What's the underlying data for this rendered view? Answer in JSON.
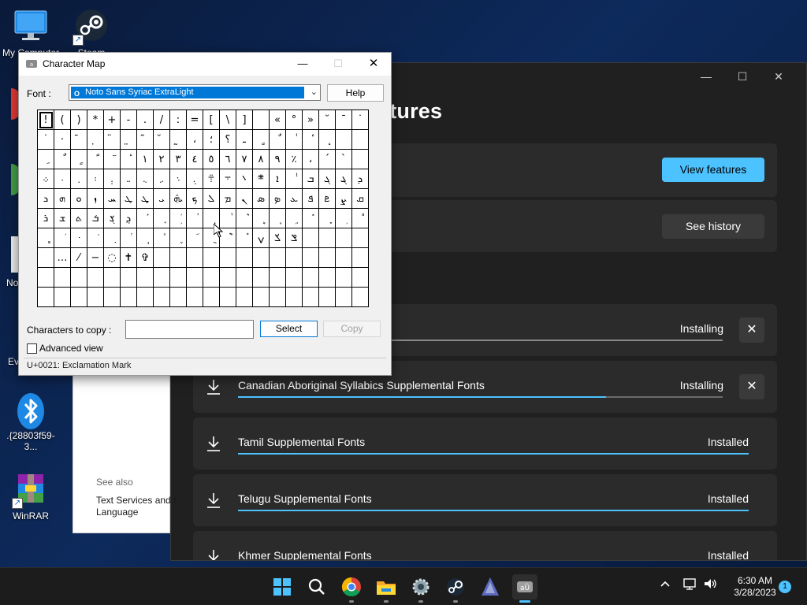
{
  "desktop": {
    "icons": [
      {
        "label": "My Computer"
      },
      {
        "label": "Steam"
      },
      {
        "label": ".{28803f59-3..."
      },
      {
        "label": "WinRAR"
      }
    ],
    "partial_labels": [
      "No",
      "Ev"
    ]
  },
  "settings": {
    "title_partial": "atures",
    "view_features_label": "View features",
    "see_history_label": "See history",
    "features": [
      {
        "name": "",
        "status": "Installing",
        "progress": 1.0,
        "cancellable": true
      },
      {
        "name": "Canadian Aboriginal Syllabics Supplemental Fonts",
        "status": "Installing",
        "progress": 0.76,
        "cancellable": true
      },
      {
        "name": "Tamil Supplemental Fonts",
        "status": "Installed",
        "progress": 1.0,
        "cancellable": false
      },
      {
        "name": "Telugu Supplemental Fonts",
        "status": "Installed",
        "progress": 1.0,
        "cancellable": false
      },
      {
        "name": "Khmer Supplemental Fonts",
        "status": "Installed",
        "progress": 1.0,
        "cancellable": false
      }
    ]
  },
  "white_panel": {
    "see_also": "See also",
    "link_line1": "Text Services and I",
    "link_line2": "Language"
  },
  "charmap": {
    "title": "Character Map",
    "font_label": "Font :",
    "font_value": "Noto Sans Syriac ExtraLight",
    "help_label": "Help",
    "copy_label": "Characters to copy :",
    "copy_value": "",
    "select_label": "Select",
    "copy_button_label": "Copy",
    "advanced_view_label": "Advanced view",
    "advanced_view_checked": false,
    "status": "U+0021: Exclamation Mark",
    "grid_rows": [
      [
        "!",
        "(",
        ")",
        "*",
        "+",
        "-",
        ".",
        "/",
        ":",
        "=",
        "[",
        "\\",
        "]",
        "",
        "«",
        "°",
        "»",
        "˘",
        "ˉ",
        "˙"
      ],
      [
        "˙",
        "·",
        "̄",
        "̣",
        "̈",
        "̤",
        "̃",
        "̆",
        "̰",
        "،",
        "؛",
        "؟",
        "ـ",
        "ٍ",
        "ٌ",
        "ٰ",
        "ٔ",
        "ٕ",
        "",
        ""
      ],
      [
        "ِ",
        "ٌ",
        "ٍ",
        "ً",
        "ٓ",
        "ٔ",
        "١",
        "٢",
        "٣",
        "٤",
        "٥",
        "٦",
        "٧",
        "٨",
        "٩",
        "٪",
        "،",
        "ˊ",
        "ˋ",
        ""
      ],
      [
        "܀",
        "܁",
        "܂",
        "܃",
        "܄",
        "܅",
        "܆",
        "܇",
        "܈",
        "܉",
        "܊",
        "܋",
        "܌",
        "܍",
        "ܐ",
        "ܑ",
        "ܒ",
        "ܓ",
        "ܔ",
        "ܕ"
      ],
      [
        "ܖ",
        "ܗ",
        "ܘ",
        "ܙ",
        "ܚ",
        "ܛ",
        "ܜ",
        "ܝ",
        "ܞ",
        "ܟ",
        "ܠ",
        "ܡ",
        "ܢ",
        "ܣ",
        "ܤ",
        "ܥ",
        "ܦ",
        "ܧ",
        "ܨ",
        "ܩ"
      ],
      [
        "ܪ",
        "ܫ",
        "ܬ",
        "ܭ",
        "ܮ",
        "ܯ",
        "ܰ",
        "ܱ",
        "ܲ",
        "ܳ",
        "ܴ",
        "ܵ",
        "ܶ",
        "ܷ",
        "ܸ",
        "ܹ",
        "ܺ",
        "ܻ",
        "ܼ",
        "ܽ"
      ],
      [
        "ܾ",
        "ܿ",
        "݀",
        "݁",
        "݂",
        "݃",
        "݄",
        "݅",
        "݆",
        "݇",
        "݈",
        "݉",
        "݊",
        "ݍ",
        "ݎ",
        "ݏ",
        "",
        "",
        "",
        ""
      ],
      [
        "",
        "…",
        "⁄",
        "−",
        "◌",
        "✝",
        "✞",
        "",
        "",
        "",
        "",
        "",
        "",
        "",
        "",
        "",
        "",
        "",
        "",
        ""
      ],
      [
        "",
        "",
        "",
        "",
        "",
        "",
        "",
        "",
        "",
        "",
        "",
        "",
        "",
        "",
        "",
        "",
        "",
        "",
        "",
        ""
      ],
      [
        "",
        "",
        "",
        "",
        "",
        "",
        "",
        "",
        "",
        "",
        "",
        "",
        "",
        "",
        "",
        "",
        "",
        "",
        "",
        ""
      ]
    ]
  },
  "taskbar": {
    "clock_time": "6:30 AM",
    "clock_date": "3/28/2023",
    "notification_count": "1",
    "apps": [
      "start-icon",
      "search-icon",
      "chrome-icon",
      "file-explorer-icon",
      "settings-icon",
      "steam-icon",
      "app-icon",
      "character-map-icon"
    ]
  },
  "colors": {
    "accent": "#4cc2ff",
    "settings_bg": "#202020",
    "card_bg": "#2b2b2b",
    "selection": "#0078d7"
  }
}
